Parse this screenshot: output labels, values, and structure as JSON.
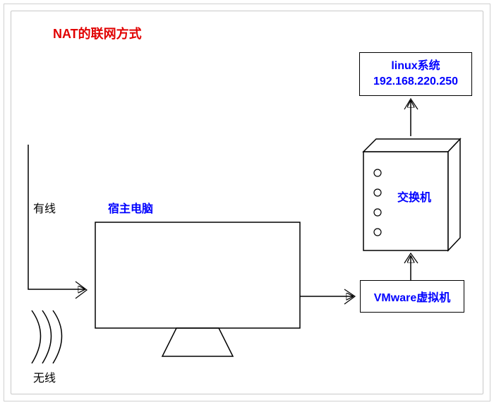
{
  "title": "NAT的联网方式",
  "labels": {
    "wired": "有线",
    "wireless": "无线",
    "host_pc": "宿主电脑",
    "switch": "交换机",
    "vmware": "VMware虚拟机",
    "linux_name": "linux系统",
    "linux_ip": "192.168.220.250"
  }
}
